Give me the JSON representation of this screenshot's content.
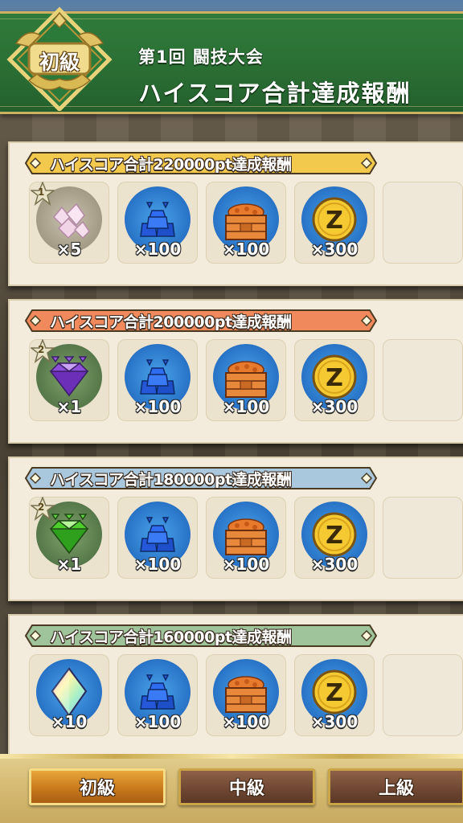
{
  "header": {
    "rank_badge": "初級",
    "subtitle": "第1回 闘技大会",
    "title": "ハイスコア合計達成報酬"
  },
  "tiers": [
    {
      "label": "ハイスコア合計220000pt達成報酬",
      "banner_color": "#f2c94c",
      "rewards": [
        {
          "icon": "gray-crystal-cluster",
          "star": "1",
          "qty": "×5"
        },
        {
          "icon": "blue-ore-pile",
          "qty": "×100"
        },
        {
          "icon": "treasure-crate",
          "qty": "×100"
        },
        {
          "icon": "zenny-coin",
          "qty": "×300"
        }
      ]
    },
    {
      "label": "ハイスコア合計200000pt達成報酬",
      "banner_color": "#f08a5d",
      "rewards": [
        {
          "icon": "purple-gem",
          "star": "2",
          "qty": "×1"
        },
        {
          "icon": "blue-ore-pile",
          "qty": "×100"
        },
        {
          "icon": "treasure-crate",
          "qty": "×100"
        },
        {
          "icon": "zenny-coin",
          "qty": "×300"
        }
      ]
    },
    {
      "label": "ハイスコア合計180000pt達成報酬",
      "banner_color": "#a9c7dd",
      "rewards": [
        {
          "icon": "green-gem",
          "star": "2",
          "qty": "×1"
        },
        {
          "icon": "blue-ore-pile",
          "qty": "×100"
        },
        {
          "icon": "treasure-crate",
          "qty": "×100"
        },
        {
          "icon": "zenny-coin",
          "qty": "×300"
        }
      ]
    },
    {
      "label": "ハイスコア合計160000pt達成報酬",
      "banner_color": "#9fc39a",
      "rewards": [
        {
          "icon": "rainbow-crystal",
          "qty": "×10"
        },
        {
          "icon": "blue-ore-pile",
          "qty": "×100"
        },
        {
          "icon": "treasure-crate",
          "qty": "×100"
        },
        {
          "icon": "zenny-coin",
          "qty": "×300"
        }
      ]
    }
  ],
  "tabs": [
    {
      "label": "初級",
      "active": true
    },
    {
      "label": "中級",
      "active": false
    },
    {
      "label": "上級",
      "active": false
    }
  ]
}
